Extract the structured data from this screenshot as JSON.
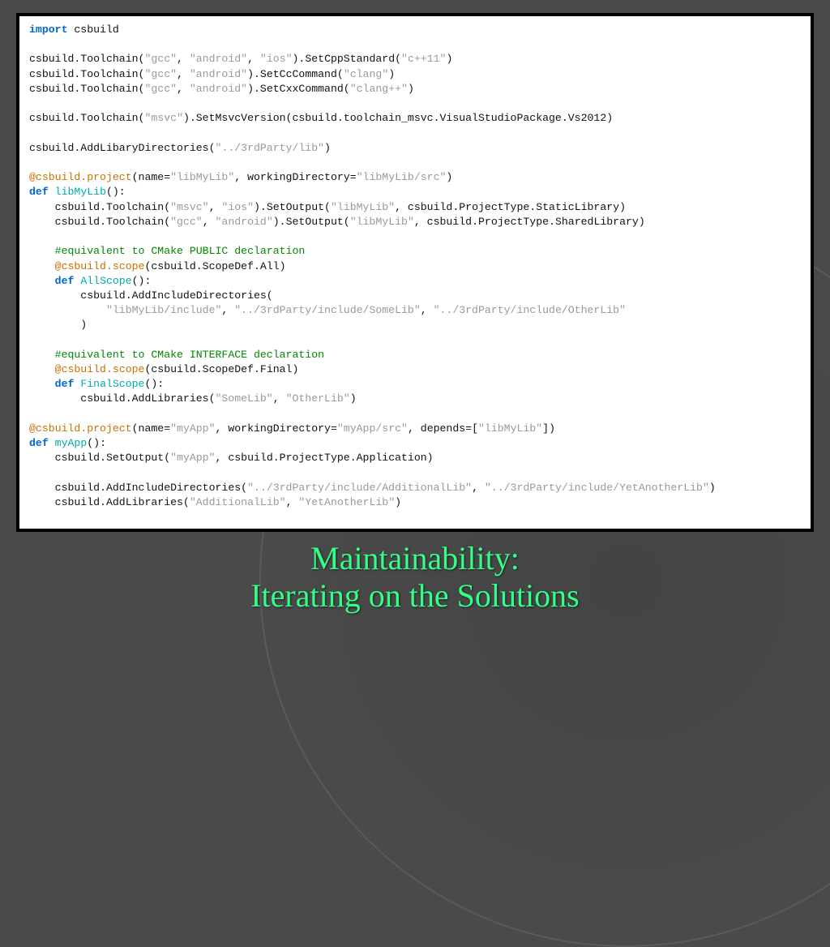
{
  "title_line1": "Maintainability:",
  "title_line2": "Iterating on the Solutions",
  "code": {
    "l1a": "import",
    "l1b": " csbuild",
    "l2a": "csbuild.Toolchain(",
    "l2b": "\"gcc\"",
    "l2c": ", ",
    "l2d": "\"android\"",
    "l2e": ", ",
    "l2f": "\"ios\"",
    "l2g": ").SetCppStandard(",
    "l2h": "\"c++11\"",
    "l2i": ")",
    "l3a": "csbuild.Toolchain(",
    "l3b": "\"gcc\"",
    "l3c": ", ",
    "l3d": "\"android\"",
    "l3e": ").SetCcCommand(",
    "l3f": "\"clang\"",
    "l3g": ")",
    "l4a": "csbuild.Toolchain(",
    "l4b": "\"gcc\"",
    "l4c": ", ",
    "l4d": "\"android\"",
    "l4e": ").SetCxxCommand(",
    "l4f": "\"clang++\"",
    "l4g": ")",
    "l5a": "csbuild.Toolchain(",
    "l5b": "\"msvc\"",
    "l5c": ").SetMsvcVersion(csbuild.toolchain_msvc.VisualStudioPackage.Vs2012)",
    "l6a": "csbuild.AddLibaryDirectories(",
    "l6b": "\"../3rdParty/lib\"",
    "l6c": ")",
    "l7a": "@csbuild.project",
    "l7b": "(name=",
    "l7c": "\"libMyLib\"",
    "l7d": ", workingDirectory=",
    "l7e": "\"libMyLib/src\"",
    "l7f": ")",
    "l8a": "def",
    "l8b": " ",
    "l8c": "libMyLib",
    "l8d": "():",
    "l9a": "    csbuild.Toolchain(",
    "l9b": "\"msvc\"",
    "l9c": ", ",
    "l9d": "\"ios\"",
    "l9e": ").SetOutput(",
    "l9f": "\"libMyLib\"",
    "l9g": ", csbuild.ProjectType.StaticLibrary)",
    "l10a": "    csbuild.Toolchain(",
    "l10b": "\"gcc\"",
    "l10c": ", ",
    "l10d": "\"android\"",
    "l10e": ").SetOutput(",
    "l10f": "\"libMyLib\"",
    "l10g": ", csbuild.ProjectType.SharedLibrary)",
    "l11": "    #equivalent to CMake PUBLIC declaration",
    "l12a": "    ",
    "l12b": "@csbuild.scope",
    "l12c": "(csbuild.ScopeDef.All)",
    "l13a": "    ",
    "l13b": "def",
    "l13c": " ",
    "l13d": "AllScope",
    "l13e": "():",
    "l14": "        csbuild.AddIncludeDirectories(",
    "l15a": "            ",
    "l15b": "\"libMyLib/include\"",
    "l15c": ", ",
    "l15d": "\"../3rdParty/include/SomeLib\"",
    "l15e": ", ",
    "l15f": "\"../3rdParty/include/OtherLib\"",
    "l16": "        )",
    "l17": "    #equivalent to CMake INTERFACE declaration",
    "l18a": "    ",
    "l18b": "@csbuild.scope",
    "l18c": "(csbuild.ScopeDef.Final)",
    "l19a": "    ",
    "l19b": "def",
    "l19c": " ",
    "l19d": "FinalScope",
    "l19e": "():",
    "l20a": "        csbuild.AddLibraries(",
    "l20b": "\"SomeLib\"",
    "l20c": ", ",
    "l20d": "\"OtherLib\"",
    "l20e": ")",
    "l21a": "@csbuild.project",
    "l21b": "(name=",
    "l21c": "\"myApp\"",
    "l21d": ", workingDirectory=",
    "l21e": "\"myApp/src\"",
    "l21f": ", depends=[",
    "l21g": "\"libMyLib\"",
    "l21h": "])",
    "l22a": "def",
    "l22b": " ",
    "l22c": "myApp",
    "l22d": "():",
    "l23a": "    csbuild.SetOutput(",
    "l23b": "\"myApp\"",
    "l23c": ", csbuild.ProjectType.Application)",
    "l24a": "    csbuild.AddIncludeDirectories(",
    "l24b": "\"../3rdParty/include/AdditionalLib\"",
    "l24c": ", ",
    "l24d": "\"../3rdParty/include/YetAnotherLib\"",
    "l24e": ")",
    "l25a": "    csbuild.AddLibraries(",
    "l25b": "\"AdditionalLib\"",
    "l25c": ", ",
    "l25d": "\"YetAnotherLib\"",
    "l25e": ")"
  }
}
